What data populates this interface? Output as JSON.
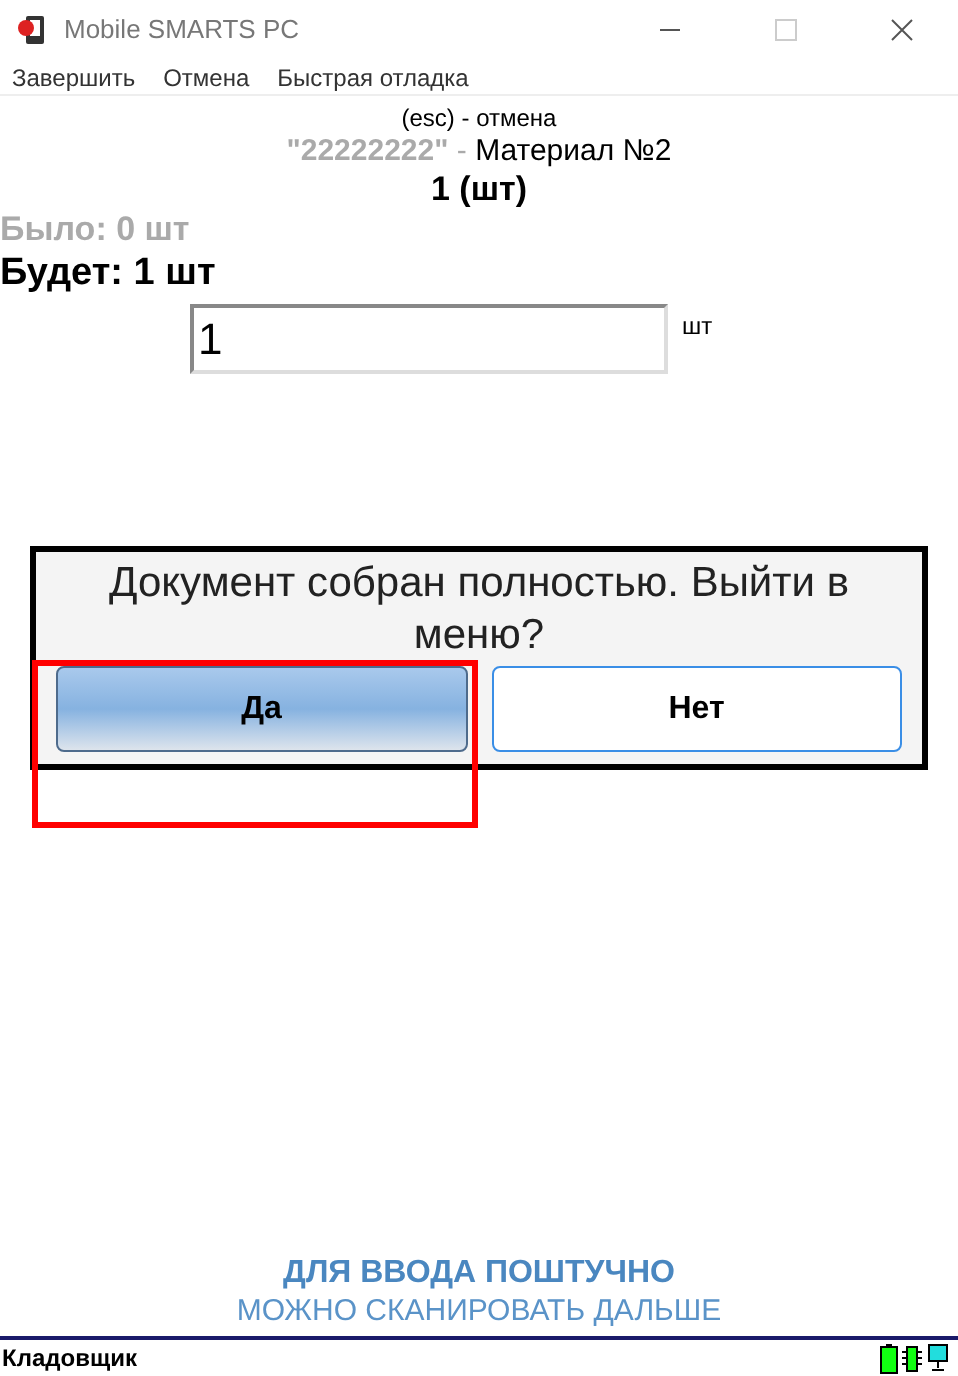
{
  "window": {
    "title": "Mobile SMARTS PC"
  },
  "menu": [
    "Завершить",
    "Отмена",
    "Быстрая отладка"
  ],
  "hint": "(esc) - отмена",
  "product": {
    "code": "\"22222222\"",
    "separator": " - ",
    "name": "Материал №2"
  },
  "quantity": "1 (шт)",
  "was": "Было: 0 шт",
  "will_be": "Будет: 1 шт",
  "input": {
    "value": "1",
    "unit": "шт"
  },
  "dialog": {
    "message": "Документ собран полностью. Выйти в меню?",
    "buttons": [
      {
        "label": "Да",
        "selected": true
      },
      {
        "label": "Нет",
        "selected": false
      }
    ]
  },
  "footer": {
    "line_1": "ДЛЯ ВВОДА ПОШТУЧНО",
    "line_2": "МОЖНО СКАНИРОВАТЬ ДАЛЬШЕ"
  },
  "status_bar": {
    "user": "Кладовщик"
  }
}
